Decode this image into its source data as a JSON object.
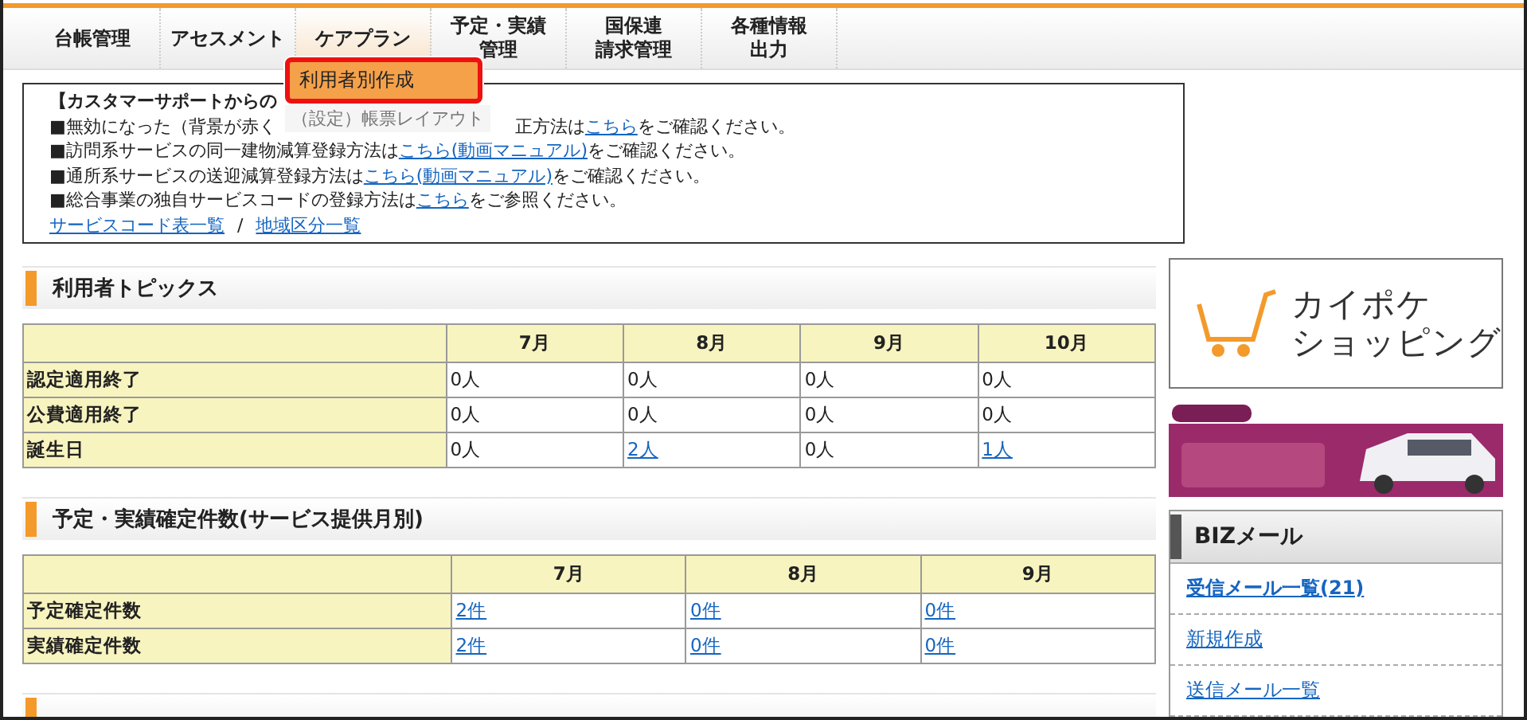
{
  "nav": {
    "tabs": [
      {
        "label": "台帳管理",
        "selected": false
      },
      {
        "label": "アセスメント",
        "selected": false
      },
      {
        "label": "ケアプラン",
        "selected": true
      },
      {
        "label_lines": [
          "予定・実績",
          "管理"
        ],
        "selected": false
      },
      {
        "label_lines": [
          "国保連",
          "請求管理"
        ],
        "selected": false
      },
      {
        "label_lines": [
          "各種情報",
          "出力"
        ],
        "selected": false
      }
    ]
  },
  "dropdown": {
    "items": [
      {
        "label": "利用者別作成",
        "selected": true
      },
      {
        "label": "（設定）帳票レイアウト",
        "selected": false
      }
    ]
  },
  "notice": {
    "title": "【カスタマーサポートからの",
    "lines": [
      {
        "before": "■無効になった（背景が赤く",
        "after": "正方法は",
        "link": "こちら",
        "tail": "をご確認ください。"
      },
      {
        "before": "■訪問系サービスの同一建物減算登録方法は",
        "link": "こちら(動画マニュアル)",
        "tail": "をご確認ください。"
      },
      {
        "before": "■通所系サービスの送迎減算登録方法は",
        "link": "こちら(動画マニュアル)",
        "tail": "をご確認ください。"
      },
      {
        "before": "■総合事業の独自サービスコードの登録方法は",
        "link": "こちら",
        "tail": "をご参照ください。"
      }
    ],
    "links": [
      "サービスコード表一覧",
      "地域区分一覧"
    ],
    "separator": "/"
  },
  "topics": {
    "title": "利用者トピックス",
    "columns": [
      "7月",
      "8月",
      "9月",
      "10月"
    ],
    "rows": [
      {
        "label": "認定適用終了",
        "cells": [
          {
            "text": "0人",
            "link": false
          },
          {
            "text": "0人",
            "link": false
          },
          {
            "text": "0人",
            "link": false
          },
          {
            "text": "0人",
            "link": false
          }
        ]
      },
      {
        "label": "公費適用終了",
        "cells": [
          {
            "text": "0人",
            "link": false
          },
          {
            "text": "0人",
            "link": false
          },
          {
            "text": "0人",
            "link": false
          },
          {
            "text": "0人",
            "link": false
          }
        ]
      },
      {
        "label": "誕生日",
        "cells": [
          {
            "text": "0人",
            "link": false
          },
          {
            "text": "2人",
            "link": true
          },
          {
            "text": "0人",
            "link": false
          },
          {
            "text": "1人",
            "link": true
          }
        ]
      }
    ]
  },
  "counts": {
    "title": "予定・実績確定件数(サービス提供月別)",
    "columns": [
      "7月",
      "8月",
      "9月"
    ],
    "rows": [
      {
        "label": "予定確定件数",
        "cells": [
          {
            "text": "2件",
            "link": true
          },
          {
            "text": "0件",
            "link": true
          },
          {
            "text": "0件",
            "link": true
          }
        ]
      },
      {
        "label": "実績確定件数",
        "cells": [
          {
            "text": "2件",
            "link": true
          },
          {
            "text": "0件",
            "link": true
          },
          {
            "text": "0件",
            "link": true
          }
        ]
      }
    ]
  },
  "shop_banner": {
    "lines": [
      "カイポケ",
      "ショッピング"
    ]
  },
  "biz_mail": {
    "title": "BIZメール",
    "links": [
      "受信メール一覧(21)",
      "新規作成",
      "送信メール一覧"
    ]
  }
}
